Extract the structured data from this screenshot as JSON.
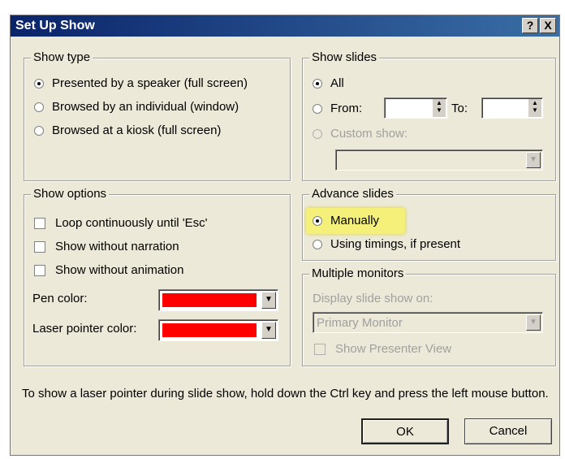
{
  "dialog": {
    "title": "Set Up Show",
    "help_icon": "?",
    "close_icon": "X"
  },
  "show_type": {
    "title": "Show type",
    "options": [
      {
        "label": "Presented by a speaker (full screen)",
        "selected": true
      },
      {
        "label": "Browsed by an individual (window)",
        "selected": false
      },
      {
        "label": "Browsed at a kiosk (full screen)",
        "selected": false
      }
    ]
  },
  "show_slides": {
    "title": "Show slides",
    "all_label": "All",
    "from_label": "From:",
    "from_value": "",
    "to_label": "To:",
    "to_value": "",
    "custom_label": "Custom show:",
    "custom_value": ""
  },
  "show_options": {
    "title": "Show options",
    "checks": [
      {
        "label": "Loop continuously until 'Esc'",
        "checked": false
      },
      {
        "label": "Show without narration",
        "checked": false
      },
      {
        "label": "Show without animation",
        "checked": false
      }
    ],
    "pen_color_label": "Pen color:",
    "pen_color": "#ff0000",
    "laser_color_label": "Laser pointer color:",
    "laser_color": "#ff0000"
  },
  "advance_slides": {
    "title": "Advance slides",
    "options": [
      {
        "label": "Manually",
        "selected": true
      },
      {
        "label": "Using timings, if present",
        "selected": false
      }
    ],
    "highlight_color": "#f4f07a"
  },
  "multiple_monitors": {
    "title": "Multiple monitors",
    "display_label": "Display slide show on:",
    "monitor_value": "Primary Monitor",
    "presenter_view_label": "Show Presenter View"
  },
  "footer": {
    "info_text": "To show a laser pointer during slide show, hold down the Ctrl key and press the left mouse button.",
    "ok_label": "OK",
    "cancel_label": "Cancel"
  }
}
